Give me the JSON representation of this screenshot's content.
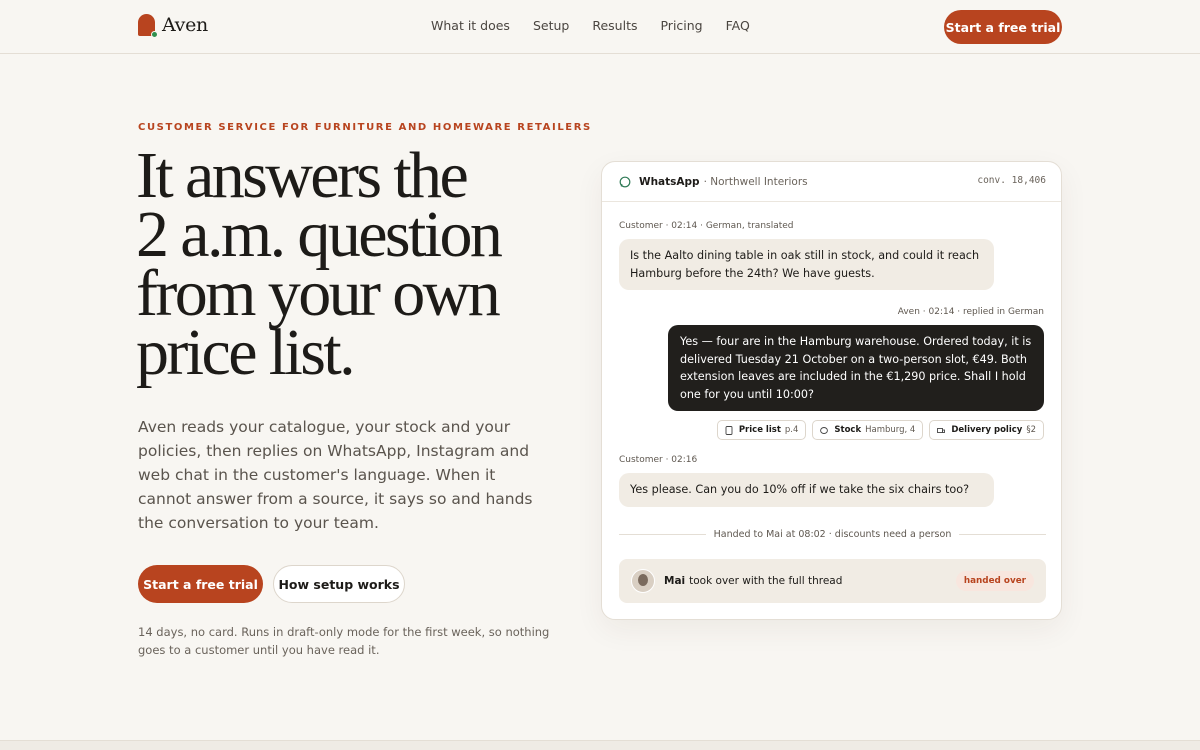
{
  "brand": {
    "name": "Aven",
    "accent": "#b8441f"
  },
  "nav": {
    "links": [
      "What it does",
      "Setup",
      "Results",
      "Pricing",
      "FAQ"
    ],
    "cta": "Start a free trial"
  },
  "hero": {
    "eyebrow": "CUSTOMER SERVICE FOR FURNITURE AND HOMEWARE RETAILERS",
    "headline": [
      "It answers the",
      "2 a.m. question",
      "from your own",
      "price list."
    ],
    "lede": "Aven reads your catalogue, your stock and your policies, then replies on WhatsApp, Instagram and web chat in the customer's language. When it cannot answer from a source, it says so and hands the conversation to your team.",
    "primary_cta": "Start a free trial",
    "secondary_cta": "How setup works",
    "fine_print": "14 days, no card. Runs in draft-only mode for the first week, so nothing goes to a customer until you have read it."
  },
  "chat": {
    "channel": "WhatsApp",
    "store": "· Northwell Interiors",
    "conversation_id": "conv. 18,406",
    "messages": [
      {
        "meta": "Customer · 02:14 · German, translated",
        "text": "Is the Aalto dining table in oak still in stock, and could it reach Hamburg before the 24th? We have guests."
      },
      {
        "meta": "Aven · 02:14 · replied in German",
        "text": "Yes — four are in the Hamburg warehouse. Ordered today, it is delivered Tuesday 21 October on a two-person slot, €49. Both extension leaves are included in the €1,290 price. Shall I hold one for you until 10:00?"
      },
      {
        "meta": "Customer · 02:16",
        "text": "Yes please. Can you do 10% off if we take the six chairs too?"
      }
    ],
    "sources": [
      {
        "label": "Price list",
        "detail": "p.4",
        "icon": "document-icon"
      },
      {
        "label": "Stock",
        "detail": "Hamburg, 4",
        "icon": "database-icon"
      },
      {
        "label": "Delivery policy",
        "detail": "§2",
        "icon": "truck-icon"
      }
    ],
    "handoff_note": "Handed to Mai at 08:02 · discounts need a person",
    "takeover": {
      "name": "Mai",
      "text": "took over with the full thread",
      "badge": "handed over"
    }
  }
}
